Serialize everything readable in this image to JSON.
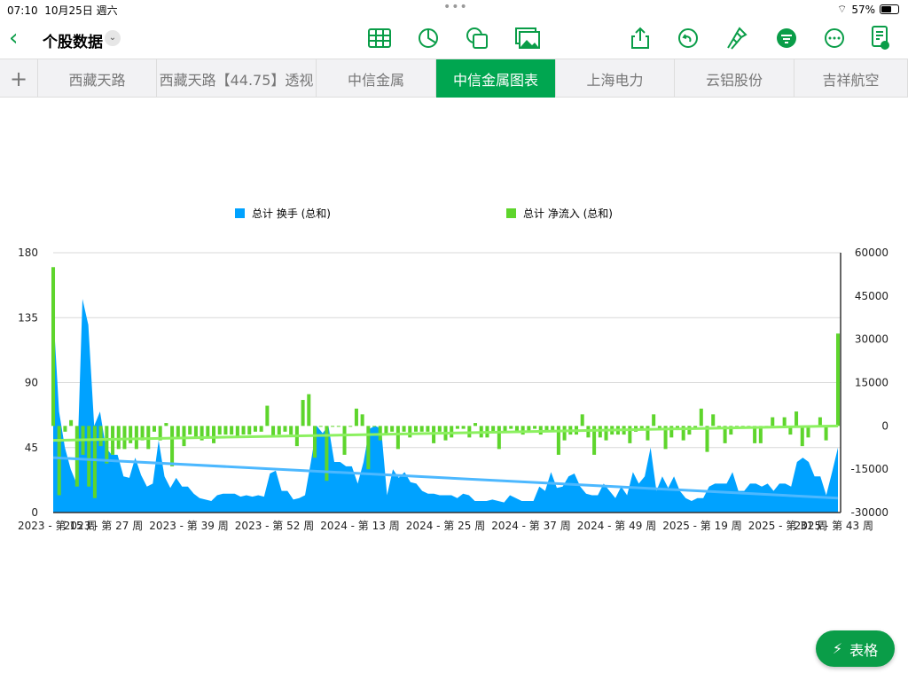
{
  "status": {
    "time": "07:10",
    "date": "10月25日 週六",
    "battery": "57%",
    "battery_level": 0.57
  },
  "toolbar": {
    "title": "个股数据",
    "icons": [
      "table-icon",
      "chart-icon",
      "shape-icon",
      "media-icon",
      "share-icon",
      "undo-icon",
      "format-brush-icon",
      "organize-icon",
      "more-icon",
      "view-options-icon"
    ]
  },
  "tabs": [
    "西藏天路",
    "西藏天路【44.75】透视",
    "中信金属",
    "中信金属图表",
    "上海电力",
    "云铝股份",
    "吉祥航空"
  ],
  "active_tab": 3,
  "fab": {
    "label": "表格"
  },
  "colors": {
    "turnover": "#00a2ff",
    "net": "#5ed52c",
    "accent": "#0a9d48"
  },
  "chart_data": {
    "type": "bar+area",
    "legend": [
      {
        "name": "总计 换手 (总和)",
        "color": "#00a2ff"
      },
      {
        "name": "总计 净流入 (总和)",
        "color": "#5ed52c"
      }
    ],
    "legend_position": "top",
    "left_axis": {
      "ticks": [
        "180",
        "135",
        "90",
        "45",
        "0"
      ],
      "range": [
        0,
        180
      ]
    },
    "right_axis": {
      "ticks": [
        "60000",
        "45000",
        "30000",
        "15000",
        "0",
        "-15000",
        "-30000"
      ],
      "range": [
        -30000,
        60000
      ]
    },
    "x_ticks": [
      "2023 - 第 15 周",
      "2023 - 第 27 周",
      "2023 - 第 39 周",
      "2023 - 第 52 周",
      "2024 - 第 13 周",
      "2024 - 第 25 周",
      "2024 - 第 37 周",
      "2024 - 第 49 周",
      "2025 - 第 19 周",
      "2025 - 第 31 周",
      "2025 - 第 43 周"
    ],
    "series": [
      {
        "name": "总计 换手 (总和)",
        "type": "area",
        "values": [
          140,
          70,
          45,
          30,
          20,
          148,
          130,
          60,
          70,
          45,
          40,
          40,
          25,
          24,
          38,
          26,
          18,
          20,
          50,
          25,
          17,
          24,
          18,
          18,
          13,
          10,
          9,
          8,
          12,
          13,
          13,
          13,
          11,
          12,
          11,
          12,
          11,
          27,
          29,
          15,
          15,
          9,
          10,
          12,
          35,
          60,
          55,
          60,
          35,
          35,
          32,
          32,
          20,
          35,
          58,
          60,
          58,
          12,
          30,
          24,
          28,
          21,
          20,
          15,
          13,
          13,
          12,
          12,
          12,
          10,
          13,
          12,
          8,
          8,
          8,
          9,
          8,
          7,
          12,
          10,
          8,
          8,
          8,
          18,
          15,
          28,
          17,
          18,
          25,
          27,
          18,
          13,
          12,
          12,
          20,
          15,
          10,
          18,
          12,
          28,
          20,
          25,
          45,
          15,
          25,
          17,
          25,
          15,
          10,
          8,
          10,
          10,
          18,
          20,
          20,
          20,
          28,
          15,
          15,
          20,
          20,
          18,
          20,
          15,
          20,
          20,
          18,
          35,
          38,
          35,
          25,
          25,
          12,
          28,
          45
        ]
      },
      {
        "name": "总计 净流入 (总和)",
        "type": "bar",
        "values": [
          55000,
          -24000,
          -2000,
          2000,
          -21000,
          -10000,
          -21000,
          -25000,
          -7000,
          -13000,
          -10000,
          -8000,
          -8000,
          -6000,
          -8000,
          -5000,
          -8000,
          -2000,
          -5000,
          1000,
          -14000,
          -4000,
          -7000,
          -3000,
          -4000,
          -5000,
          -4000,
          -6000,
          -3000,
          -3000,
          -3000,
          -4000,
          -3000,
          -3000,
          -2000,
          -2000,
          7000,
          -4000,
          -3000,
          -2000,
          -3000,
          -7000,
          9000,
          11000,
          -11000,
          0,
          -19000,
          0,
          0,
          -10000,
          0,
          6000,
          4000,
          -15000,
          0,
          -5000,
          -3000,
          -2000,
          -8000,
          -2000,
          -4000,
          -2000,
          -2000,
          -2000,
          -6000,
          -2000,
          -5000,
          -4000,
          -1000,
          -1000,
          -4000,
          1000,
          -4000,
          -4000,
          -2000,
          -8000,
          -2000,
          -1000,
          -2000,
          -3000,
          -2000,
          -1000,
          -3000,
          -2000,
          -2000,
          -10000,
          -5000,
          -3000,
          -3000,
          4000,
          -4000,
          -10000,
          -4000,
          -5000,
          -3000,
          -3000,
          -3000,
          -6000,
          -2000,
          -1000,
          -5000,
          4000,
          -1000,
          -8000,
          -4000,
          -1000,
          -5000,
          -3000,
          -1000,
          6000,
          -9000,
          4000,
          -1000,
          -6000,
          -3000,
          -1000,
          0,
          0,
          -6000,
          -6000,
          0,
          3000,
          0,
          3000,
          -3000,
          5000,
          -7000,
          -4000,
          0,
          3000,
          -5000,
          0,
          32000
        ]
      }
    ],
    "trendlines": [
      {
        "series": "总计 换手 (总和)",
        "start": 38,
        "end": 10
      },
      {
        "series": "总计 净流入 (总和)",
        "start": -5000,
        "end": 0
      }
    ]
  }
}
